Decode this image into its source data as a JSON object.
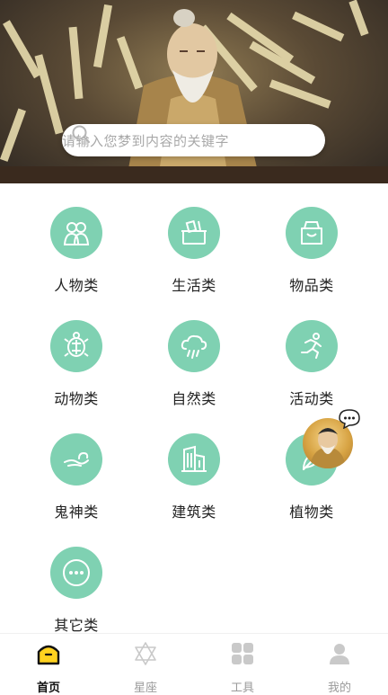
{
  "search": {
    "placeholder": "请输入您梦到内容的关键字"
  },
  "categories": [
    {
      "label": "人物类",
      "icon": "people-icon"
    },
    {
      "label": "生活类",
      "icon": "basket-icon"
    },
    {
      "label": "物品类",
      "icon": "bag-icon"
    },
    {
      "label": "动物类",
      "icon": "turtle-icon"
    },
    {
      "label": "自然类",
      "icon": "cloud-rain-icon"
    },
    {
      "label": "活动类",
      "icon": "running-icon"
    },
    {
      "label": "鬼神类",
      "icon": "cloud-wisp-icon"
    },
    {
      "label": "建筑类",
      "icon": "building-icon"
    },
    {
      "label": "植物类",
      "icon": "leaf-icon"
    },
    {
      "label": "其它类",
      "icon": "more-icon"
    }
  ],
  "nav": [
    {
      "label": "首页",
      "icon": "home-icon",
      "active": true
    },
    {
      "label": "星座",
      "icon": "star-of-david-icon",
      "active": false
    },
    {
      "label": "工具",
      "icon": "grid-icon",
      "active": false
    },
    {
      "label": "我的",
      "icon": "profile-icon",
      "active": false
    }
  ],
  "colors": {
    "accent": "#7fd1b2",
    "home_tab": "#ffd21f"
  }
}
